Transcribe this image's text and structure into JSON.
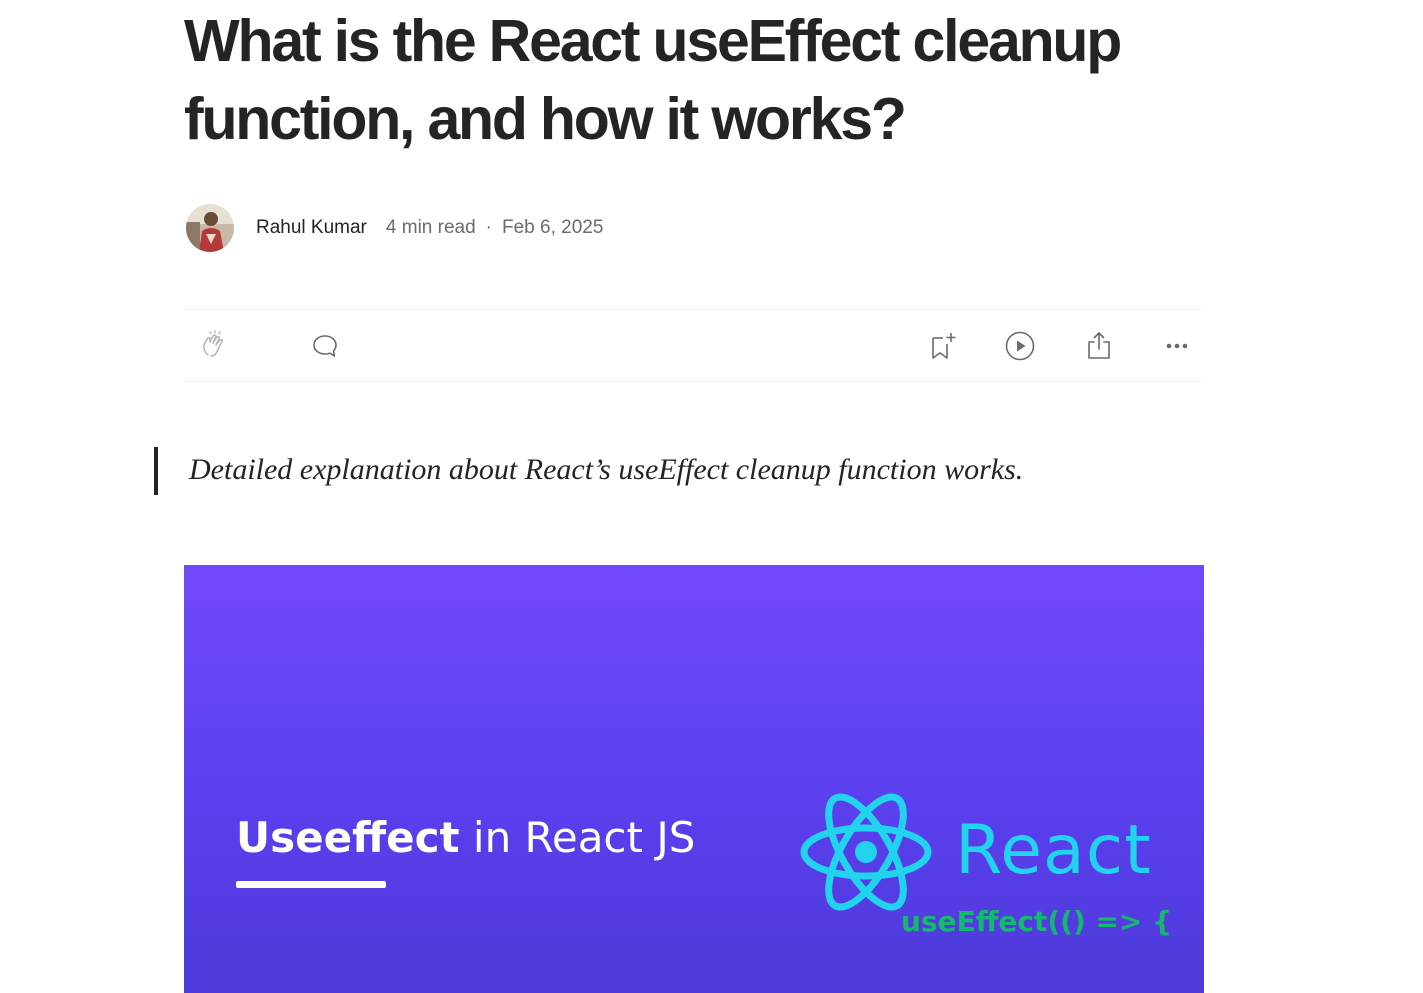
{
  "article": {
    "title": "What is the React useEffect cleanup function, and how it works?",
    "author": "Rahul Kumar",
    "read_time": "4 min read",
    "separator": "·",
    "date": "Feb 6, 2025",
    "subtitle": "Detailed explanation about React’s useEffect cleanup function works."
  },
  "actions": {
    "icons": [
      "clap-icon",
      "comment-icon",
      "bookmark-add-icon",
      "play-icon",
      "share-icon",
      "more-icon"
    ]
  },
  "hero_image": {
    "headline_bold": "Useeffect",
    "headline_rest": " in React JS",
    "logo_text": "React",
    "code_text": "useEffect(() => {",
    "colors": {
      "background_top": "#7149fb",
      "background_bottom": "#4d3ad9",
      "react_cyan": "#22d3ee",
      "code_green": "#15b86f"
    }
  },
  "colors": {
    "text_primary": "#242424",
    "text_secondary": "#6b6b6b",
    "divider": "#f2f2f2"
  }
}
